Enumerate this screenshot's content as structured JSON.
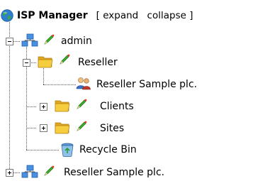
{
  "tree": {
    "title": "ISP Manager",
    "bracket_open": "[",
    "bracket_close": "]",
    "expand_label": "expand",
    "collapse_label": "collapse",
    "nodes": [
      {
        "label": "admin",
        "icon": "server-network-icon",
        "expanded": true
      },
      {
        "label": "Reseller",
        "icon": "folder-icon",
        "expanded": true
      },
      {
        "label": "Reseller Sample plc.",
        "icon": "users-group-icon"
      },
      {
        "label": "Clients",
        "icon": "folder-icon",
        "expanded": false
      },
      {
        "label": "Sites",
        "icon": "folder-icon",
        "expanded": false
      },
      {
        "label": "Recycle Bin",
        "icon": "recycle-bin-icon"
      },
      {
        "label": "Reseller Sample plc.",
        "icon": "server-network-icon",
        "expanded": false
      }
    ]
  },
  "colors": {
    "globe": "#2f7fd0",
    "globe_land": "#3aa83a",
    "folder": "#f2c230",
    "pencil_body": "#3fae2a",
    "pencil_tip": "#e23a2a",
    "network_blue": "#2f7fd0"
  }
}
